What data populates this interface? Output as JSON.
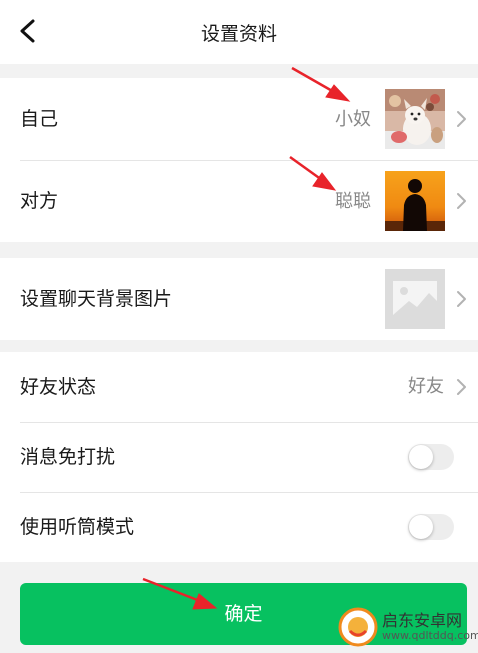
{
  "header": {
    "title": "设置资料",
    "back_icon": "chevron-left-icon"
  },
  "profile": {
    "self": {
      "label": "自己",
      "value": "小奴",
      "avatar": "dog-photo-avatar"
    },
    "other": {
      "label": "对方",
      "value": "聪聪",
      "avatar": "sunset-silhouette-avatar"
    }
  },
  "background": {
    "label": "设置聊天背景图片",
    "placeholder_icon": "image-placeholder-icon"
  },
  "settings": {
    "friend_status": {
      "label": "好友状态",
      "value": "好友"
    },
    "mute": {
      "label": "消息免打扰",
      "enabled": false
    },
    "earpiece": {
      "label": "使用听筒模式",
      "enabled": false
    }
  },
  "confirm_label": "确定",
  "watermark": {
    "text": "启东安卓网",
    "url": "www.qdltddq.com"
  },
  "colors": {
    "accent": "#07c160",
    "annotation": "#e8232a",
    "page_bg": "#f2f2f2"
  }
}
